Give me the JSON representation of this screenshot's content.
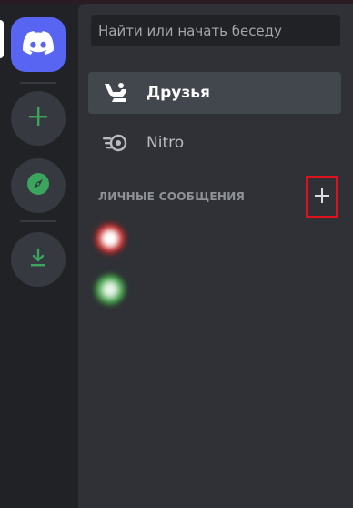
{
  "search": {
    "placeholder": "Найти или начать беседу"
  },
  "nav": {
    "friends_label": "Друзья",
    "nitro_label": "Nitro"
  },
  "direct_messages": {
    "header": "ЛИЧНЫЕ СООБЩЕНИЯ",
    "items": [
      {
        "name": "",
        "avatar_color": "#c62828"
      },
      {
        "name": "",
        "avatar_color": "#43a047"
      }
    ]
  },
  "icons": {
    "rail_home": "discord-logo-icon",
    "rail_add": "plus-icon",
    "rail_explore": "compass-icon",
    "rail_download": "download-icon",
    "friends": "friends-wave-icon",
    "nitro": "nitro-icon",
    "add_dm": "plus-icon"
  },
  "colors": {
    "brand": "#5865f2",
    "green": "#3ba55d",
    "highlight": "#e0101c"
  }
}
